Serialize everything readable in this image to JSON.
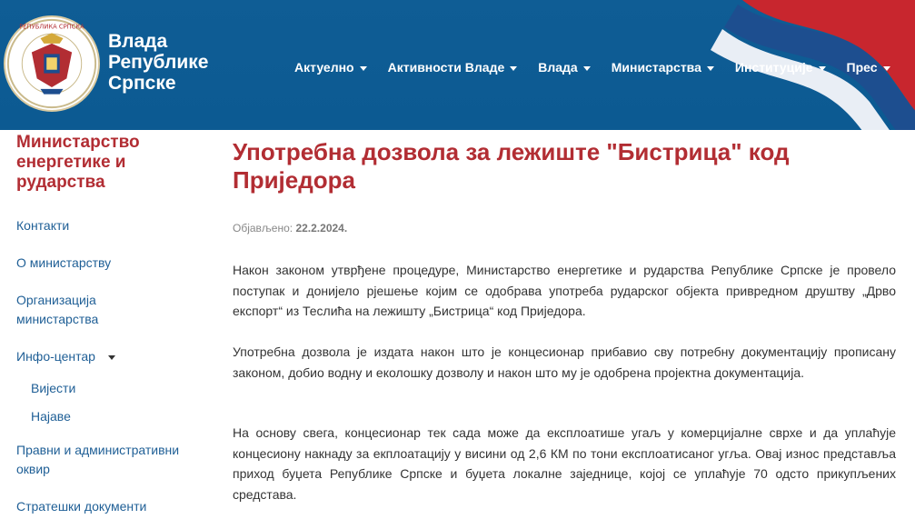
{
  "header": {
    "brand_line1": "Влада",
    "brand_line2": "Републике",
    "brand_line3": "Српске",
    "logo_ring_text": "РЕПУБЛИКА СРПСКА",
    "nav": [
      {
        "label": "Актуелно"
      },
      {
        "label": "Активности Владе"
      },
      {
        "label": "Влада"
      },
      {
        "label": "Министарства"
      },
      {
        "label": "Институције"
      },
      {
        "label": "Прес"
      }
    ]
  },
  "sidebar": {
    "title": "Министарство енергетике и рударства",
    "items": [
      {
        "label": "Контакти"
      },
      {
        "label": "О министарству"
      },
      {
        "label": "Организација министарства"
      },
      {
        "label": "Инфо-центар"
      },
      {
        "label": "Правни и административни оквир"
      },
      {
        "label": "Стратешки документи"
      }
    ],
    "subitems": [
      {
        "label": "Вијести"
      },
      {
        "label": "Најаве"
      }
    ]
  },
  "article": {
    "title": "Употребна дозвола за лежиште \"Бистрица\" код Приједора",
    "published_label": "Објављено:",
    "published_date": "22.2.2024.",
    "paragraphs": [
      "Након законом утврђене процедуре, Министарство енергетике и рударства Републике Српске је провело поступак и донијело рјешење којим се одобрава употреба рударског објекта привредном друштву „Дрво експорт“ из Теслића на лежишту „Бистрица“ код Приједора.",
      "Употребна дозвола је издата након што је концесионар прибавио сву потребну документацију прописану законом, добио водну и еколошку дозволу и након што му је одобрена пројектна документација.",
      "На основу свега, концесионар тек сада може да експлоатише угаљ у комерцијалне сврхе и да уплаћује концесиону накнаду за екплоатацију у висини од 2,6 КМ по тони експлоатисаног угља. Овај износ представља приход буџета Републике Српске и буџета локалне заједнице, којој се уплаћује 70 одсто прикупљених средстава."
    ]
  },
  "colors": {
    "header_bg": "#0c5a92",
    "accent_red": "#b22d33",
    "link_blue": "#1f5f96"
  }
}
